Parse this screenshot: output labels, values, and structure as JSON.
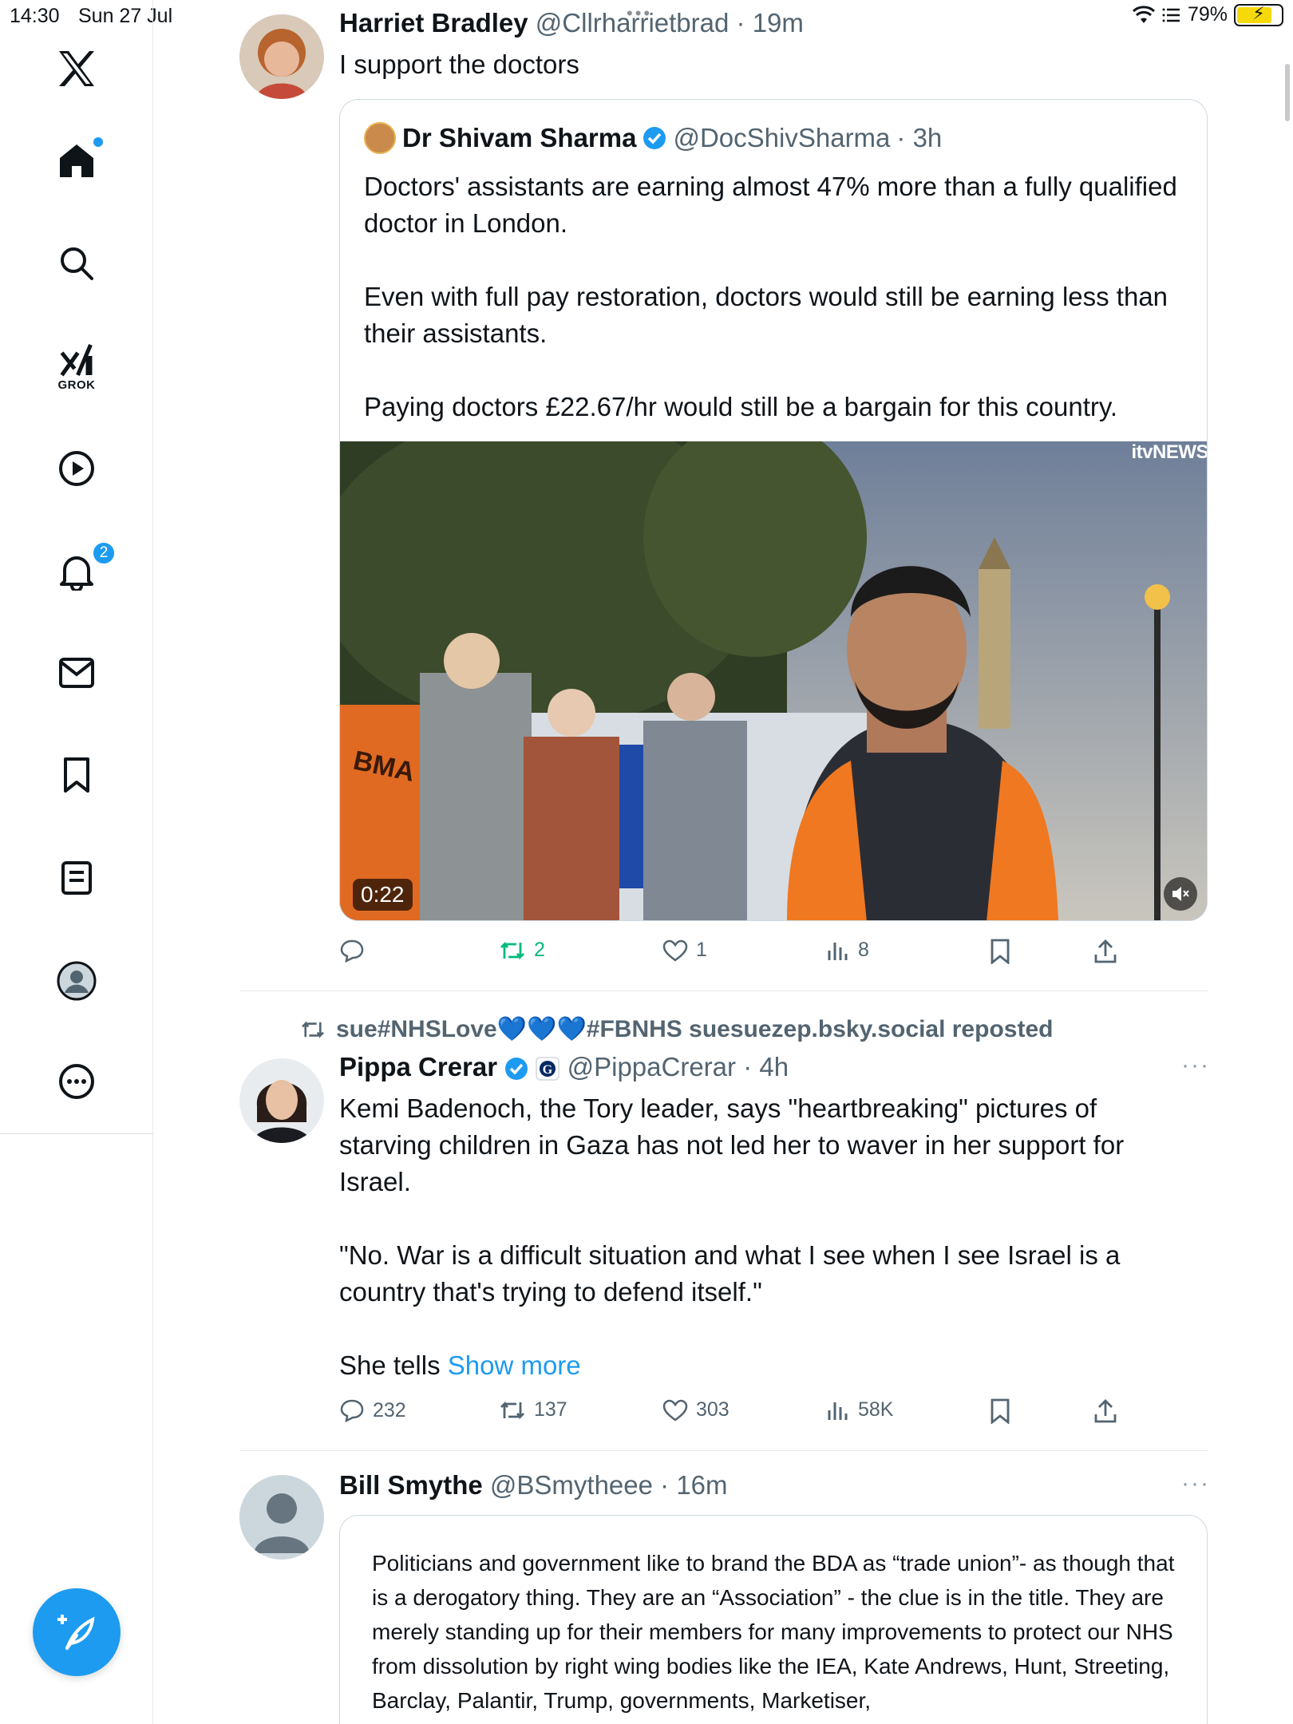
{
  "status_bar": {
    "time": "14:30",
    "date": "Sun 27 Jul",
    "battery": "79%",
    "battery_level": 0.79
  },
  "sidebar": {
    "items": [
      {
        "name": "x-logo-icon"
      },
      {
        "name": "home-icon"
      },
      {
        "name": "search-icon"
      },
      {
        "name": "grok-icon",
        "label": "GROK"
      },
      {
        "name": "video-icon"
      },
      {
        "name": "notifications-icon",
        "badge": "2"
      },
      {
        "name": "messages-icon"
      },
      {
        "name": "bookmarks-icon"
      },
      {
        "name": "lists-icon"
      },
      {
        "name": "profile-icon"
      },
      {
        "name": "more-icon"
      }
    ],
    "compose_icon": "compose-feather-icon"
  },
  "tweets": [
    {
      "name": "Harriet Bradley",
      "handle": "@Cllrharrietbrad",
      "time": "· 19m",
      "text": "I support the doctors",
      "quote": {
        "name": "Dr Shivam Sharma",
        "handle": "@DocShivSharma",
        "time": "· 3h",
        "text": "Doctors' assistants are earning almost 47% more than a fully qualified doctor in London.\n\nEven with full pay restoration, doctors would still be earning less than their assistants.\n\nPaying doctors £22.67/hr would still be a bargain for this country.",
        "video_duration": "0:22",
        "video_brand": "itvNEWS",
        "video_sign": "BMA"
      },
      "replies": "",
      "reposts": "2",
      "likes": "1",
      "views": "8"
    },
    {
      "repost_label": "sue#NHSLove💙💙💙#FBNHS suesuezep.bsky.social reposted",
      "name": "Pippa Crerar",
      "handle": "@PippaCrerar",
      "time": "· 4h",
      "text": "Kemi Badenoch, the Tory leader, says \"heartbreaking\" pictures of starving children in Gaza has not led her to waver in her support for Israel.\n\n\"No. War is a difficult situation and what I see when I see Israel is a country that's trying to defend itself.\"\n\nShe tells",
      "show_more": "Show more",
      "replies": "232",
      "reposts": "137",
      "likes": "303",
      "views": "58K"
    },
    {
      "name": "Bill Smythe",
      "handle": "@BSmytheee",
      "time": "· 16m",
      "card_text": "Politicians and government like to brand the BDA as “trade union”- as though that is a derogatory thing. They are an “Association” - the clue is in the title. They are merely standing up for their members for many improvements to protect our NHS from dissolution by right wing bodies like the IEA, Kate Andrews, Hunt, Streeting, Barclay, Palantir, Trump, governments, Marketiser,"
    }
  ],
  "colors": {
    "accent": "#1d9bf0",
    "repost_green": "#00ba7c",
    "text": "#0f1419",
    "secondary": "#536471"
  }
}
